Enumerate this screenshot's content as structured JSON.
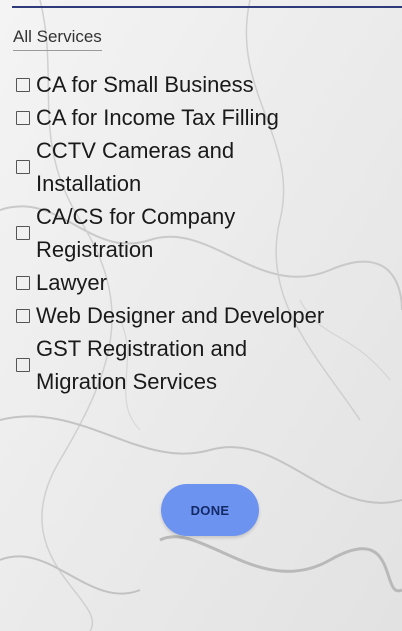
{
  "header": {
    "title": "All Services"
  },
  "services": [
    {
      "lines": [
        "CA for Small Business"
      ],
      "checked": false
    },
    {
      "lines": [
        "CA for Income Tax Filling"
      ],
      "checked": false
    },
    {
      "lines": [
        "CCTV Cameras and",
        "Installation"
      ],
      "checked": false
    },
    {
      "lines": [
        "CA/CS for Company",
        "Registration"
      ],
      "checked": false
    },
    {
      "lines": [
        "Lawyer"
      ],
      "checked": false
    },
    {
      "lines": [
        "Web Designer and Developer"
      ],
      "checked": false
    },
    {
      "lines": [
        "GST Registration and",
        "Migration Services"
      ],
      "checked": false
    }
  ],
  "actions": {
    "done_label": "DONE"
  },
  "colors": {
    "accent": "#6c93f0",
    "top_bar": "#2f3a7a",
    "background": "#ededed"
  }
}
